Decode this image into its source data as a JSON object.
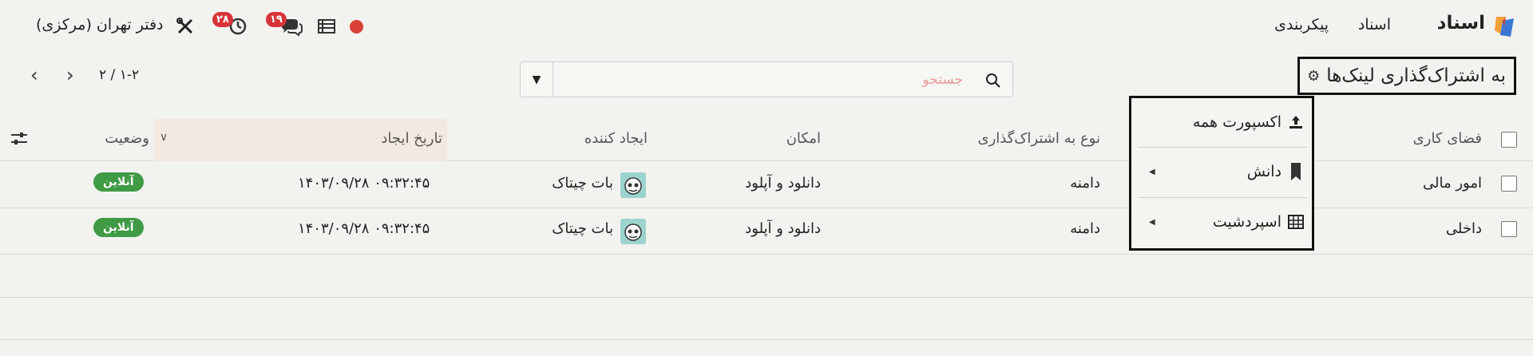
{
  "app": {
    "brand": "اسناد",
    "nav": [
      "اسناد",
      "پیکربندی"
    ],
    "company": "دفتر تهران (مرکزی)",
    "badges": {
      "messages": "۱۹",
      "activities": "۲۸"
    }
  },
  "control": {
    "title": "به اشتراک‌گذاری لینک‌ها",
    "search_placeholder": "جستجو",
    "pager": "۱-۲ / ۲"
  },
  "menu": {
    "items": [
      {
        "label": "اکسپورت همه",
        "icon": "upload-icon"
      },
      {
        "label": "دانش",
        "icon": "bookmark-icon"
      },
      {
        "label": "اسپردشیت",
        "icon": "table-grid-icon"
      }
    ]
  },
  "table": {
    "columns": [
      "فضای کاری",
      "نوع به اشتراک‌گذاری",
      "امکان",
      "ایجاد کننده",
      "تاریخ ایجاد",
      "وضعیت"
    ],
    "rows": [
      {
        "workspace": "امور مالی",
        "type": "دامنه",
        "permission": "دانلود و آپلود",
        "creator": "بات چیتاک",
        "created": "۱۴۰۳/۰۹/۲۸ ۰۹:۳۲:۴۵",
        "status": "آنلاین"
      },
      {
        "workspace": "داخلی",
        "type": "دامنه",
        "permission": "دانلود و آپلود",
        "creator": "بات چیتاک",
        "created": "۱۴۰۳/۰۹/۲۸ ۰۹:۳۲:۴۵",
        "status": "آنلاین"
      }
    ]
  },
  "colors": {
    "danger": "#d7343a",
    "success": "#3f9a44",
    "sorted_header": "#f4e9e0"
  }
}
